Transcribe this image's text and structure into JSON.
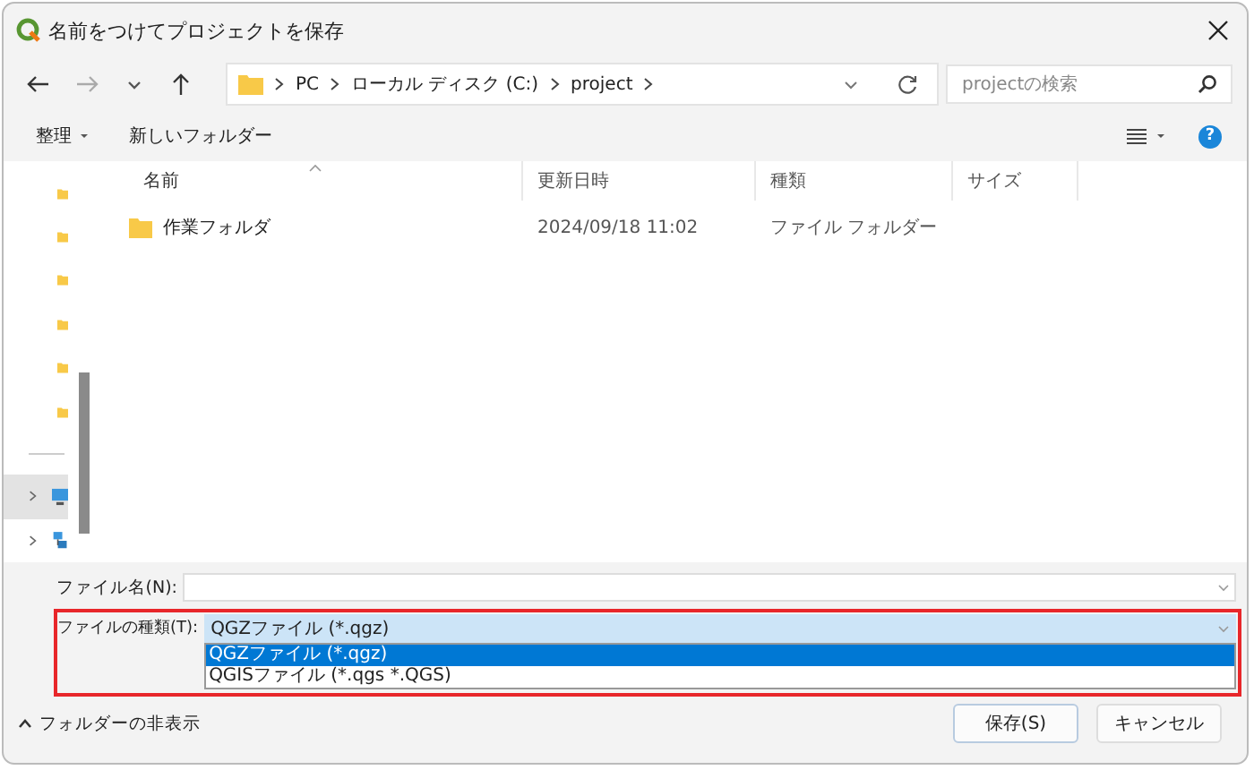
{
  "window": {
    "title": "名前をつけてプロジェクトを保存"
  },
  "nav": {
    "back_enabled": true,
    "forward_enabled": false
  },
  "address_bar": {
    "breadcrumbs": [
      "PC",
      "ローカル ディスク (C:)",
      "project"
    ]
  },
  "search": {
    "placeholder": "projectの検索"
  },
  "toolbar": {
    "organize": "整理",
    "new_folder": "新しいフォルダー",
    "help": "?"
  },
  "sidebar": {
    "items": [
      {
        "kind": "folder",
        "selected": false
      },
      {
        "kind": "folder",
        "selected": false
      },
      {
        "kind": "folder",
        "selected": false
      },
      {
        "kind": "folder",
        "selected": false
      },
      {
        "kind": "folder",
        "selected": false
      },
      {
        "kind": "folder",
        "selected": false
      },
      {
        "kind": "computer",
        "selected": true
      },
      {
        "kind": "network",
        "selected": false
      }
    ]
  },
  "table": {
    "columns": [
      {
        "label": "名前",
        "sorted": true
      },
      {
        "label": "更新日時",
        "sorted": false
      },
      {
        "label": "種類",
        "sorted": false
      },
      {
        "label": "サイズ",
        "sorted": false
      }
    ],
    "rows": [
      {
        "name": "作業フォルダ",
        "modified": "2024/09/18 11:02",
        "type": "ファイル フォルダー"
      }
    ]
  },
  "file_name": {
    "label": "ファイル名(N):"
  },
  "file_type": {
    "label": "ファイルの種類(T):",
    "value": "QGZファイル (*.qgz)",
    "expanded": true,
    "highlighted": true,
    "options": [
      {
        "label": "QGZファイル (*.qgz)",
        "selected": true
      },
      {
        "label": "QGISファイル (*.qgs *.QGS)",
        "selected": false
      }
    ]
  },
  "footer": {
    "toggle_folders": "フォルダーの非表示",
    "buttons": [
      {
        "label": "保存(S)",
        "default": true
      },
      {
        "label": "キャンセル",
        "default": false
      }
    ]
  }
}
